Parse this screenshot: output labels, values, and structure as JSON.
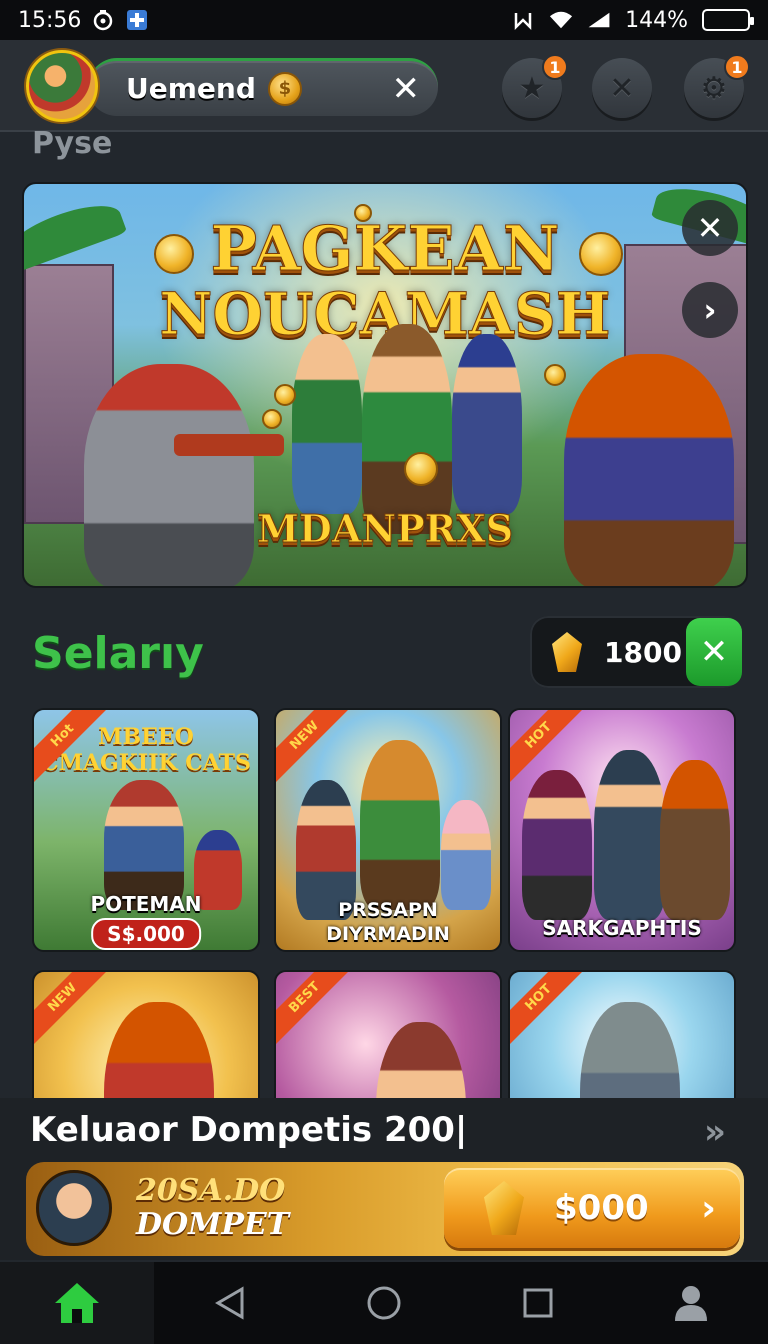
{
  "status_bar": {
    "time": "15:56",
    "battery": "144%"
  },
  "header": {
    "player_name": "Uemend",
    "badges": {
      "star": "1",
      "settings": "1"
    }
  },
  "section_label": "Pyse",
  "banner": {
    "title_line1": "PAGKEAN",
    "title_line2": "NOUCAMASH",
    "subtitle": "MDANPRXS"
  },
  "selection": {
    "title": "Selarıy",
    "currency_amount": "1800"
  },
  "cards": [
    {
      "ribbon": "Hot",
      "header": "MBEEO CMAGKIIK CATS",
      "title": "POTEMAN",
      "price": "S$.000"
    },
    {
      "ribbon": "NEW",
      "title": "PRSSAPN DIYRMADIN"
    },
    {
      "ribbon": "HOT",
      "title": "SARKGAPHTIS"
    },
    {
      "ribbon": "NEW"
    },
    {
      "ribbon": "BEST"
    },
    {
      "ribbon": "HOT"
    }
  ],
  "promo": {
    "label": "Keluaor Dompetis 200|",
    "text_line1": "20SA.DO",
    "text_line2": "DOMPET",
    "price": "$000"
  },
  "colors": {
    "accent_green": "#3ec24a",
    "gold": "#f0b429",
    "badge_orange": "#f07b1d"
  }
}
